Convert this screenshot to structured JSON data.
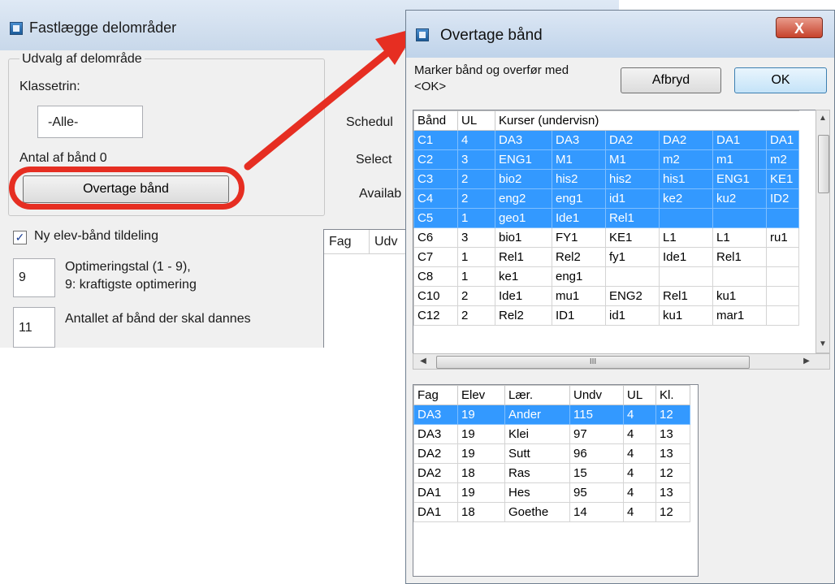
{
  "main_window": {
    "title": "Fastlægge delområder",
    "group_title": "Udvalg af delområde",
    "klassetrin_label": "Klassetrin:",
    "klassetrin_value": "-Alle-",
    "antal_label": "Antal af bånd 0",
    "overtage_button": "Overtage bånd",
    "ny_elev_checkbox": "Ny elev-bånd tildeling",
    "ny_elev_checked": true,
    "optimering_value": "9",
    "optimering_label_1": "Optimeringstal (1 - 9),",
    "optimering_label_2": "9: kraftigste optimering",
    "antal_baand_value": "11",
    "antal_baand_label": "Antallet af bånd der skal dannes",
    "schedul_label": "Schedul",
    "select_label": "Select",
    "availab_label": "Availab",
    "table_fag": "Fag",
    "table_udv": "Udv"
  },
  "dialog": {
    "title": "Overtage bånd",
    "close_glyph": "X",
    "instruction_line1": "Marker bånd og overfør med",
    "instruction_line2": "<OK>",
    "cancel_button": "Afbryd",
    "ok_button": "OK",
    "bands_table": {
      "headers": [
        "Bånd",
        "UL",
        "Kurser (undervisn)"
      ],
      "rows": [
        {
          "cells": [
            "C1",
            "4",
            "DA3",
            "DA3",
            "DA2",
            "DA2",
            "DA1",
            "DA1"
          ],
          "selected": true
        },
        {
          "cells": [
            "C2",
            "3",
            "ENG1",
            "M1",
            "M1",
            "m2",
            "m1",
            "m2"
          ],
          "selected": true
        },
        {
          "cells": [
            "C3",
            "2",
            "bio2",
            "his2",
            "his2",
            "his1",
            "ENG1",
            "KE1"
          ],
          "selected": true
        },
        {
          "cells": [
            "C4",
            "2",
            "eng2",
            "eng1",
            "id1",
            "ke2",
            "ku2",
            "ID2"
          ],
          "selected": true
        },
        {
          "cells": [
            "C5",
            "1",
            "geo1",
            "Ide1",
            "Rel1",
            "",
            "",
            ""
          ],
          "selected": true
        },
        {
          "cells": [
            "C6",
            "3",
            "bio1",
            "FY1",
            "KE1",
            "L1",
            "L1",
            "ru1"
          ],
          "selected": false
        },
        {
          "cells": [
            "C7",
            "1",
            "Rel1",
            "Rel2",
            "fy1",
            "Ide1",
            "Rel1",
            ""
          ],
          "selected": false
        },
        {
          "cells": [
            "C8",
            "1",
            "ke1",
            "eng1",
            "",
            "",
            "",
            ""
          ],
          "selected": false
        },
        {
          "cells": [
            "C10",
            "2",
            "Ide1",
            "mu1",
            "ENG2",
            "Rel1",
            "ku1",
            ""
          ],
          "selected": false
        },
        {
          "cells": [
            "C12",
            "2",
            "Rel2",
            "ID1",
            "id1",
            "ku1",
            "mar1",
            ""
          ],
          "selected": false
        }
      ]
    },
    "hscroll_grip": "III",
    "detail_table": {
      "headers": [
        "Fag",
        "Elev",
        "Lær.",
        "Undv",
        "UL",
        "Kl."
      ],
      "rows": [
        {
          "cells": [
            "DA3",
            "19",
            "Ander",
            "115",
            "4",
            "12"
          ],
          "selected": true
        },
        {
          "cells": [
            "DA3",
            "19",
            "Klei",
            "97",
            "4",
            "13"
          ],
          "selected": false
        },
        {
          "cells": [
            "DA2",
            "19",
            "Sutt",
            "96",
            "4",
            "13"
          ],
          "selected": false
        },
        {
          "cells": [
            "DA2",
            "18",
            "Ras",
            "15",
            "4",
            "12"
          ],
          "selected": false
        },
        {
          "cells": [
            "DA1",
            "19",
            "Hes",
            "95",
            "4",
            "13"
          ],
          "selected": false
        },
        {
          "cells": [
            "DA1",
            "18",
            "Goethe",
            "14",
            "4",
            "12"
          ],
          "selected": false
        }
      ]
    }
  },
  "colors": {
    "selection": "#3399ff",
    "annotation_red": "#e62e22"
  }
}
